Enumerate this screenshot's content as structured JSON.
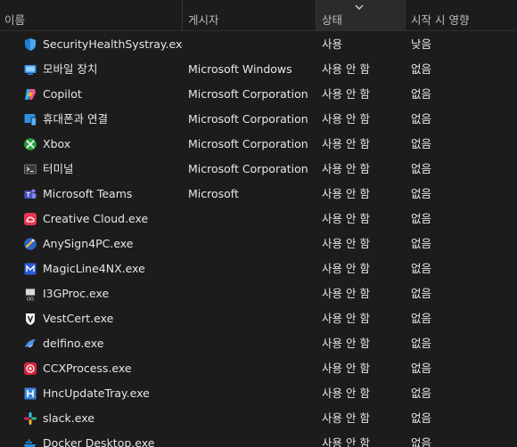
{
  "columns": {
    "name": "이름",
    "publisher": "게시자",
    "status": "상태",
    "impact": "시작 시 영향"
  },
  "rows": [
    {
      "icon": "windows-security-shield-icon",
      "name": "SecurityHealthSystray.exe",
      "publisher": "",
      "status": "사용",
      "impact": "낮음"
    },
    {
      "icon": "mobile-device-icon",
      "name": "모바일 장치",
      "publisher": "Microsoft Windows",
      "status": "사용 안 함",
      "impact": "없음"
    },
    {
      "icon": "copilot-icon",
      "name": "Copilot",
      "publisher": "Microsoft Corporation",
      "status": "사용 안 함",
      "impact": "없음"
    },
    {
      "icon": "phone-link-icon",
      "name": "휴대폰과 연결",
      "publisher": "Microsoft Corporation",
      "status": "사용 안 함",
      "impact": "없음"
    },
    {
      "icon": "xbox-icon",
      "name": "Xbox",
      "publisher": "Microsoft Corporation",
      "status": "사용 안 함",
      "impact": "없음"
    },
    {
      "icon": "terminal-icon",
      "name": "터미널",
      "publisher": "Microsoft Corporation",
      "status": "사용 안 함",
      "impact": "없음"
    },
    {
      "icon": "teams-icon",
      "name": "Microsoft Teams",
      "publisher": "Microsoft",
      "status": "사용 안 함",
      "impact": "없음"
    },
    {
      "icon": "creative-cloud-icon",
      "name": "Creative Cloud.exe",
      "publisher": "",
      "status": "사용 안 함",
      "impact": "없음"
    },
    {
      "icon": "anysign-icon",
      "name": "AnySign4PC.exe",
      "publisher": "",
      "status": "사용 안 함",
      "impact": "없음"
    },
    {
      "icon": "magicline-icon",
      "name": "MagicLine4NX.exe",
      "publisher": "",
      "status": "사용 안 함",
      "impact": "없음"
    },
    {
      "icon": "i3gproc-icon",
      "name": "I3GProc.exe",
      "publisher": "",
      "status": "사용 안 함",
      "impact": "없음"
    },
    {
      "icon": "vestcert-icon",
      "name": "VestCert.exe",
      "publisher": "",
      "status": "사용 안 함",
      "impact": "없음"
    },
    {
      "icon": "delfino-icon",
      "name": "delfino.exe",
      "publisher": "",
      "status": "사용 안 함",
      "impact": "없음"
    },
    {
      "icon": "ccxprocess-icon",
      "name": "CCXProcess.exe",
      "publisher": "",
      "status": "사용 안 함",
      "impact": "없음"
    },
    {
      "icon": "hnc-update-icon",
      "name": "HncUpdateTray.exe",
      "publisher": "",
      "status": "사용 안 함",
      "impact": "없음"
    },
    {
      "icon": "slack-icon",
      "name": "slack.exe",
      "publisher": "",
      "status": "사용 안 함",
      "impact": "없음"
    },
    {
      "icon": "docker-icon",
      "name": "Docker Desktop.exe",
      "publisher": "",
      "status": "사용 안 함",
      "impact": "없음"
    }
  ],
  "colors": {
    "background": "#1c1c1c",
    "text": "#e6e6e6",
    "header_text": "#bdbdbd",
    "sorted_header_bg": "#2b2b2b"
  }
}
